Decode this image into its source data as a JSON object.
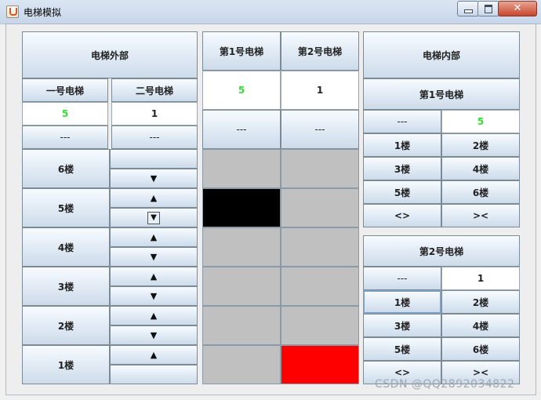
{
  "window": {
    "title": "电梯模拟"
  },
  "outside": {
    "header": "电梯外部",
    "elevator1_label": "一号电梯",
    "elevator2_label": "二号电梯",
    "elevator1_floor": "5",
    "elevator2_floor": "1",
    "elevator1_status": "---",
    "elevator2_status": "---",
    "floors": [
      "6楼",
      "5楼",
      "4楼",
      "3楼",
      "2楼",
      "1楼"
    ],
    "up_arrow": "▲",
    "down_arrow": "▼"
  },
  "shaft": {
    "elevator1_header": "第1号电梯",
    "elevator2_header": "第2号电梯",
    "elevator1_floor": "5",
    "elevator2_floor": "1",
    "elevator1_status": "---",
    "elevator2_status": "---",
    "elevator1_car_floor": 5,
    "elevator2_car_floor": 1,
    "elevator1_car_color": "#000000",
    "elevator2_car_color": "#ff0000",
    "empty_color": "#c0c0c0"
  },
  "inside": {
    "header": "电梯内部",
    "e1": {
      "header": "第1号电梯",
      "status": "---",
      "floor": "5",
      "buttons": [
        "1楼",
        "2楼",
        "3楼",
        "4楼",
        "5楼",
        "6楼",
        "<>",
        "><"
      ]
    },
    "e2": {
      "header": "第2号电梯",
      "status": "---",
      "floor": "1",
      "buttons": [
        "1楼",
        "2楼",
        "3楼",
        "4楼",
        "5楼",
        "6楼",
        "<>",
        "><"
      ]
    }
  },
  "watermark": "CSDN @QQ2892034822"
}
